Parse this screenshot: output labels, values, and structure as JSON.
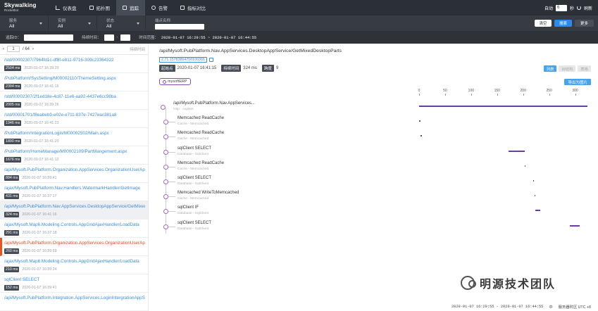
{
  "app": {
    "logo_main": "Skywalking",
    "logo_sub": "Rocketbot"
  },
  "nav": [
    {
      "label": "仪表盘",
      "icon": "dashboard-icon"
    },
    {
      "label": "拓扑图",
      "icon": "topology-icon"
    },
    {
      "label": "追踪",
      "icon": "trace-icon",
      "active": true
    },
    {
      "label": "告警",
      "icon": "alarm-icon"
    },
    {
      "label": "指标对比",
      "icon": "compare-icon"
    }
  ],
  "topright": {
    "auto_label": "自动",
    "auto_value": "6",
    "seconds": "秒",
    "refresh": "刷新"
  },
  "filters": {
    "service": {
      "label": "服务",
      "value": "All"
    },
    "instance": {
      "label": "实例",
      "value": "All"
    },
    "status": {
      "label": "状态",
      "value": "All"
    },
    "endpoint": {
      "label": "端点名称",
      "value": ""
    }
  },
  "filters2": {
    "trace_id_label": "追踪ID：",
    "duration_label": "持续时间：",
    "duration_sep": "-",
    "range_label": "时间范围：",
    "range_value": "2020-01-07 16:29:55 ~ 2020-01-07 16:44:55"
  },
  "buttons": {
    "clear": "清空",
    "search": "搜索",
    "more": "更多"
  },
  "pager": {
    "page": "1",
    "total": "/ 64",
    "sort": "持续时间"
  },
  "traces": [
    {
      "name": "/std/00002307/7964fd1c-df8f-e811-9716-309c23364322",
      "dur": "2504 ms",
      "time": "2020-01-07 16:39:20"
    },
    {
      "name": "/PubPlatform/SysSetting/M00002110/ThemeSetting.aspx",
      "dur": "2394 ms",
      "time": "2020-01-07 16:41:16"
    },
    {
      "name": "/std/00002307/2f1ed18e-4c87-11e6-aa92-4437e6cc98ba",
      "dur": "2005 ms",
      "time": "2020-01-07 16:39:26"
    },
    {
      "name": "/std/00001701/f8eabeb9-e02e-e711-837e-7427eac381a8",
      "dur": "1946 ms",
      "time": "2020-01-07 16:41:23"
    },
    {
      "name": "/PubPlatform/IntegrationLogin/M00002502/Main.aspx",
      "dur": "1890 ms",
      "time": "2020-01-07 16:41:20"
    },
    {
      "name": "/PubPlatform/HomeManage/M00002109/PartMangement.aspx",
      "dur": "1676 ms",
      "time": "2020-01-07 16:41:12"
    },
    {
      "name": "/api/Mysoft.PubPlatform.Organization.AppServices.OrganizationUserAppService",
      "dur": "884 ms",
      "time": "2020-01-07 16:39:41"
    },
    {
      "name": "/ajax/Mysoft.PubPlatform.Nav.Handlers.WatermarkHandler/GetImage",
      "dur": "431 ms",
      "time": "2020-01-07 16:37:17"
    },
    {
      "name": "/api/Mysoft.PubPlatform.Nav.AppServices.DesktopAppService/GetMixedDesktopParts",
      "dur": "324 ms",
      "time": "2020-01-07 16:41:16",
      "selected": true
    },
    {
      "name": "/ajax/Mysoft.Map6.Modeling.Controls.AppGridAjaxHandler/LoadData",
      "dur": "291 ms",
      "time": "2020-01-07 16:37:18"
    },
    {
      "name": "/api/Mysoft.PubPlatform.Organization.AppServices.OrganizationUserAppService",
      "dur": "260 ms",
      "time": "2020-01-07 16:39:59",
      "error": true
    },
    {
      "name": "/ajax/Mysoft.Map6.Modeling.Controls.AppGridAjaxHandler/LoadData",
      "dur": "210 ms",
      "time": "2020-01-07 16:39:24"
    },
    {
      "name": "sqlClient SELECT",
      "dur": "152 ms",
      "time": "2020-01-07 16:39:41"
    },
    {
      "name": "/api/Mysoft.PubPlatform.Integration.AppServices.LoginIntergrationAppService",
      "dur": "",
      "time": ""
    }
  ],
  "detail": {
    "endpoint": "/api/Mysoft.PubPlatform.Nav.AppServices.DesktopAppService/GetMixedDesktopParts",
    "trace_id": "2.71.15783864750100366",
    "start_label": "起始点",
    "start_value": "2020-01-07 16:41:15",
    "duration_label": "持续时间",
    "duration_value": "324 ms",
    "span_label": "跨度",
    "span_value": "9",
    "views": [
      "列表",
      "树结构",
      "表格"
    ],
    "service": "mysoftERP",
    "export": "导出为图片"
  },
  "axis": {
    "ticks": [
      "0",
      "50",
      "100",
      "150",
      "200",
      "250",
      "300"
    ],
    "max": 325
  },
  "spans": [
    {
      "name": "/api/Mysoft.PubPlatform.Nav.AppServices...",
      "sub": "Http - AspNet",
      "start": 0,
      "end": 324,
      "root": true
    },
    {
      "name": "Memcached ReadCache",
      "sub": "Cache - Memcached",
      "start": 0,
      "end": 2
    },
    {
      "name": "Memcached ReadCache",
      "sub": "Cache - Memcached",
      "start": 3,
      "end": 5
    },
    {
      "name": "sqlClient SELECT",
      "sub": "Database - SqlClient",
      "start": 172,
      "end": 203
    },
    {
      "name": "Memcached ReadCache",
      "sub": "Cache - Memcached",
      "start": 203,
      "end": 205
    },
    {
      "name": "sqlClient SELECT",
      "sub": "Database - SqlClient",
      "start": 219,
      "end": 221
    },
    {
      "name": "Memcached WriteToMemcached",
      "sub": "Cache - Memcached",
      "start": 222,
      "end": 224
    },
    {
      "name": "sqlClient IF",
      "sub": "Database - SqlClient",
      "start": 224,
      "end": 233
    },
    {
      "name": "sqlClient SELECT",
      "sub": "Database - SqlClient",
      "start": 290,
      "end": 309
    }
  ],
  "status": {
    "range": "2020-01-07 16:29:55 - 2020-01-07 16:44:55",
    "lang": "中",
    "tz": "服务器时区 UTC +8"
  },
  "watermark": "明源技术团队"
}
